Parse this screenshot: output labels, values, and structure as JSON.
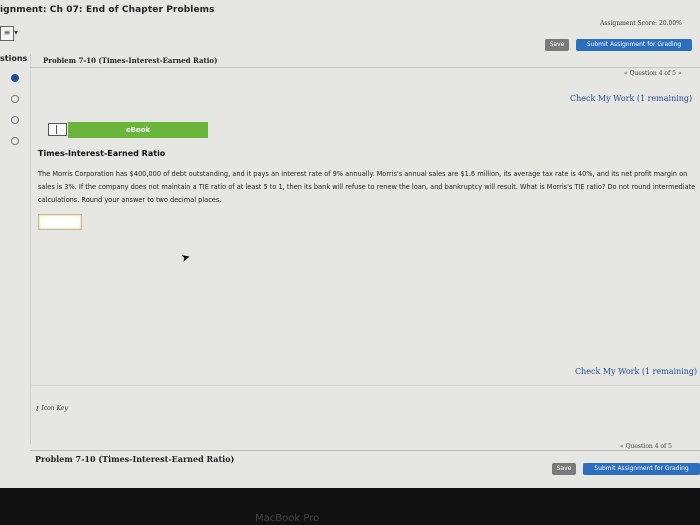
{
  "header": {
    "assignment_title": "ignment: Ch 07: End of Chapter Problems",
    "assignment_score": "Assignment Score: 20.00%",
    "save_label": "Save",
    "submit_label": "Submit Assignment for Grading",
    "menu_icon": "list-icon"
  },
  "sidebar": {
    "label": "stions",
    "questions": [
      {
        "state": "active"
      },
      {
        "state": "open"
      },
      {
        "state": "open"
      },
      {
        "state": "open"
      },
      {
        "state": "open"
      }
    ]
  },
  "problem": {
    "title": "Problem 7-10 (Times-Interest-Earned Ratio)",
    "question_nav": "« Question 4 of 5 »",
    "check_work": "Check My Work (1 remaining)",
    "ebook_label": "eBook",
    "question_title": "Times-Interest-Earned Ratio",
    "question_text": "The Morris Corporation has $400,000 of debt outstanding, and it pays an interest rate of 9% annually. Morris's annual sales are $1.6 million, its average tax rate is 40%, and its net profit margin on sales is 3%. If the company does not maintain a TIE ratio of at least 5 to 1, then its bank will refuse to renew the loan, and bankruptcy will result. What is Morris's TIE ratio? Do not round intermediate calculations. Round your answer to two decimal places.",
    "answer_value": ""
  },
  "footer": {
    "check_work": "Check My Work (1 remaining)",
    "icon_key": "Icon Key",
    "question_nav": "« Question 4 of 5",
    "problem_title": "Problem 7-10 (Times-Interest-Earned Ratio)",
    "save_label": "Save",
    "submit_label": "Submit Assignment for Grading"
  },
  "device": {
    "bezel_label": "MacBook Pro"
  },
  "colors": {
    "accent_blue": "#2c6fc1",
    "ebook_green": "#6ab63a",
    "link_blue": "#1f4f96",
    "save_gray": "#7a7a7a"
  }
}
